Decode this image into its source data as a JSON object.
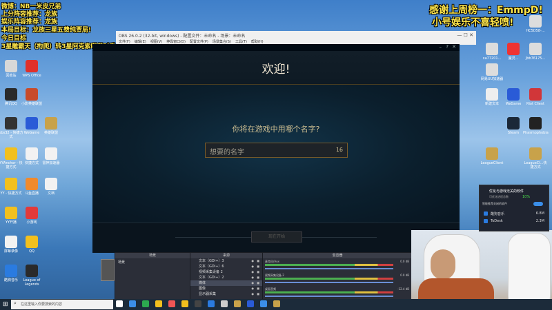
{
  "overlay": {
    "line1": "微博：NB一米皮兄弟",
    "line2": "上分阵容推荐：龙族",
    "line3": "娱乐阵容推荐：龙族",
    "line4": "本局目标：龙族三星五费纯贾局!",
    "line5": "今日目标",
    "line6": "3星雕霸天（拘爬）转3星阿克索喝退对手!",
    "thanks1": "感谢上周榜一：EmmpD!",
    "thanks2": "小号娱乐不喜轻喷!"
  },
  "desktop_left": [
    {
      "label": "回收站",
      "color": "#d8d8d8"
    },
    {
      "label": "WPS Office",
      "color": "#e0302a"
    },
    {
      "label": "腾讯QQ",
      "color": "#2a2a2a"
    },
    {
      "label": "小影英雄联盟",
      "color": "#c84b2a"
    },
    {
      "label": "obs32 - 快捷方式",
      "color": "#333333"
    },
    {
      "label": "WeGame",
      "color": "#2a5bd7"
    },
    {
      "label": "英雄联盟",
      "color": "#c8a24a"
    },
    {
      "label": "YYAnchor - 快捷方式",
      "color": "#f2c01e"
    },
    {
      "label": "快捷方式",
      "color": "#f2f2f2"
    },
    {
      "label": "雷神加速器",
      "color": "#f2f2f2"
    },
    {
      "label": "YY - 快捷方式",
      "color": "#f2c01e"
    },
    {
      "label": "斗鱼直播",
      "color": "#f08a2c"
    },
    {
      "label": "文档",
      "color": "#f2f2f2"
    },
    {
      "label": "YY开播",
      "color": "#f2c01e"
    },
    {
      "label": "小游戏",
      "color": "#e23a3a"
    },
    {
      "label": "屏幕录像",
      "color": "#f2f2f2"
    },
    {
      "label": "QQ",
      "color": "#f2c01e"
    },
    {
      "label": "酷狗音乐",
      "color": "#2a7be0"
    },
    {
      "label": "League of Legends",
      "color": "#2a2a2a"
    }
  ],
  "desktop_right": [
    {
      "label": "HC5D58-..."
    },
    {
      "label": "xa77201..."
    },
    {
      "label": "魔灵..."
    },
    {
      "label": "Jbb76175..."
    },
    {
      "label": "网易UU加速器"
    },
    {
      "label": "WeGame"
    },
    {
      "label": "新建文本"
    },
    {
      "label": "Steam"
    },
    {
      "label": "Riot Client"
    },
    {
      "label": "Phasmophobia"
    },
    {
      "label": "LeagueClient"
    },
    {
      "label": "LeagueCl...快捷方式"
    }
  ],
  "obs_window": {
    "title": "OBS 26.0.2 (32-bit, windows) - 配置文件：未命名 - 场景：未命名",
    "menu": [
      "文件(F)",
      "编辑(E)",
      "视图(V)",
      "停靠窗口(D)",
      "配置文件(P)",
      "场景集合(S)",
      "工具(T)",
      "帮助(H)"
    ]
  },
  "lol_dialog": {
    "title": "欢迎!",
    "question": "你将在游戏中用哪个名字?",
    "input_placeholder": "想要的名字",
    "char_limit": "16",
    "start_button": "现在开始"
  },
  "obs_docks": {
    "scenes_title": "场景",
    "scene_item": "场景",
    "sources_title": "来源",
    "sources": [
      "文本（GDI+）3",
      "文本（GDI+）6",
      "视频采集设备 2",
      "文本（GDI+）2",
      "媒体",
      "图像",
      "显示器采集"
    ],
    "mixer_title": "混音器",
    "mixer_tracks": [
      {
        "name": "麦克风/Aux",
        "value": "0.0 dB"
      },
      {
        "name": "视频采集设备 2",
        "value": "0.0 dB"
      },
      {
        "name": "桌面音频",
        "value": "-12.4 dB"
      }
    ]
  },
  "popup": {
    "title": "优化与游戏无关的软件",
    "subtitle": "可优化进程总数",
    "percent": "10%",
    "option": "智能推荐关闭的软件",
    "apps": [
      {
        "name": "酷狗音乐",
        "value": "6.8M"
      },
      {
        "name": "ToDesk",
        "value": "2.3M"
      }
    ]
  },
  "taskbar": {
    "search_placeholder": "在这里输入你要搜索的内容"
  },
  "colors": {
    "lol_gold": "#c8aa6e",
    "obs_bg": "#2b2e38",
    "taskbar": "#1c2b3a"
  }
}
